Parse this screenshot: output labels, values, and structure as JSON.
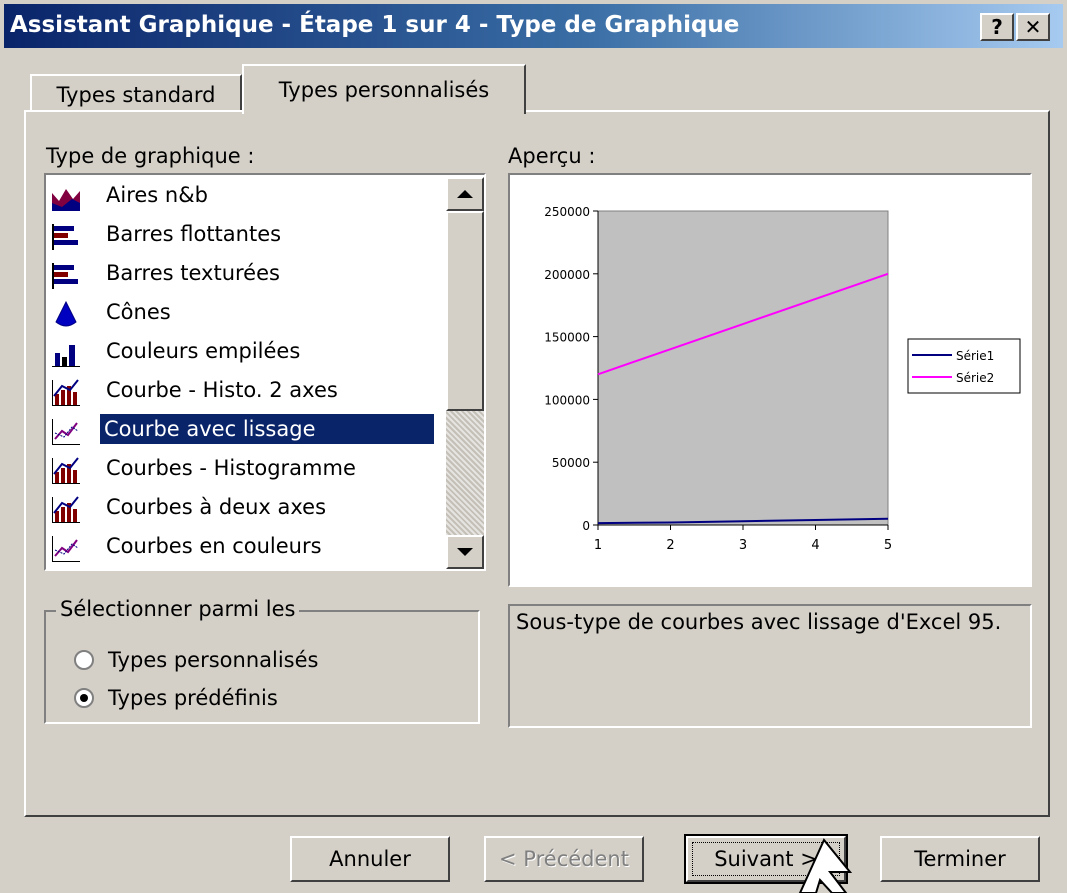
{
  "window": {
    "title": "Assistant Graphique - Étape 1 sur 4 - Type de Graphique",
    "help_label": "?",
    "close_label": "✕"
  },
  "tabs": [
    {
      "label": "Types standard",
      "active": false
    },
    {
      "label": "Types personnalisés",
      "active": true
    }
  ],
  "chart_type_list": {
    "label": "Type de graphique :",
    "items": [
      {
        "label": "Aires n&b",
        "icon": "area-chart-icon",
        "selected": false
      },
      {
        "label": "Barres flottantes",
        "icon": "bar-chart-icon",
        "selected": false
      },
      {
        "label": "Barres texturées",
        "icon": "bar-chart-icon",
        "selected": false
      },
      {
        "label": "Cônes",
        "icon": "cone-icon",
        "selected": false
      },
      {
        "label": "Couleurs empilées",
        "icon": "column-chart-icon",
        "selected": false
      },
      {
        "label": "Courbe - Histo. 2 axes",
        "icon": "line-column-icon",
        "selected": false
      },
      {
        "label": "Courbe avec lissage",
        "icon": "line-chart-icon",
        "selected": true
      },
      {
        "label": "Courbes - Histogramme",
        "icon": "line-column-icon",
        "selected": false
      },
      {
        "label": "Courbes à deux axes",
        "icon": "line-column-icon",
        "selected": false
      },
      {
        "label": "Courbes en couleurs",
        "icon": "line-chart-icon",
        "selected": false
      }
    ]
  },
  "select_group": {
    "label": "Sélectionner parmi les",
    "options": [
      {
        "label": "Types personnalisés",
        "checked": false
      },
      {
        "label": "Types prédéfinis",
        "checked": true
      }
    ]
  },
  "preview": {
    "label": "Aperçu :"
  },
  "description": "Sous-type de courbes avec lissage d'Excel 95.",
  "buttons": {
    "cancel": "Annuler",
    "previous": "< Précédent",
    "next": "Suivant >",
    "finish": "Terminer"
  },
  "colors": {
    "title_bar": "#0a246a",
    "selection": "#0a246a",
    "plot_area": "#c0c0c0",
    "serie1": "#000080",
    "serie2": "#ff00ff"
  },
  "chart_data": {
    "type": "line",
    "x": [
      1,
      2,
      3,
      4,
      5
    ],
    "series": [
      {
        "name": "Série1",
        "values": [
          1500,
          2000,
          3000,
          4000,
          5000
        ],
        "color": "#000080"
      },
      {
        "name": "Série2",
        "values": [
          120000,
          140000,
          160000,
          180000,
          200000
        ],
        "color": "#ff00ff"
      }
    ],
    "yticks": [
      "0",
      "50000",
      "100000",
      "150000",
      "200000",
      "250000"
    ],
    "xticks": [
      "1",
      "2",
      "3",
      "4",
      "5"
    ],
    "ylim": [
      0,
      250000
    ],
    "xlim": [
      1,
      5
    ],
    "legend": "right",
    "grid": false
  }
}
